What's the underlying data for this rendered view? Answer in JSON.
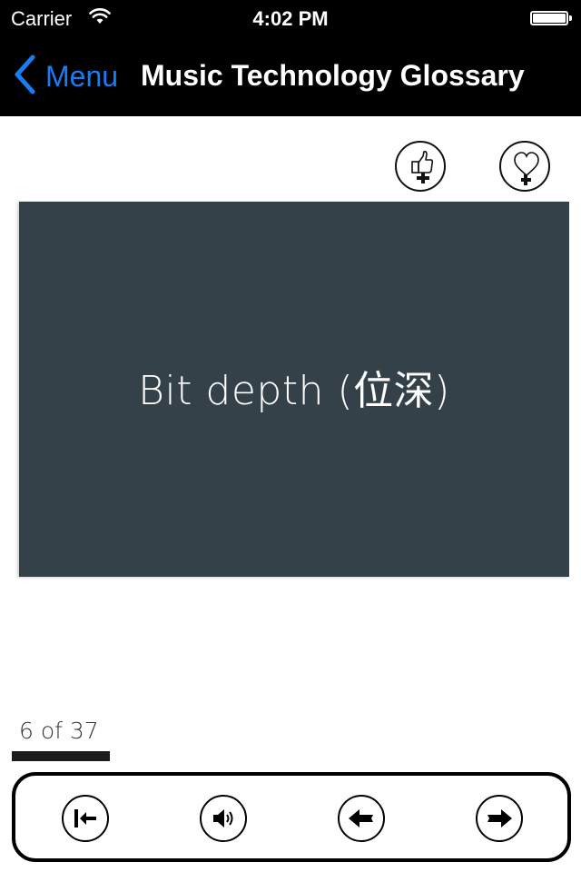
{
  "status_bar": {
    "carrier": "Carrier",
    "time": "4:02 PM",
    "wifi_icon": "wifi-icon",
    "battery_icon": "battery-icon",
    "battery_level_percent": 100
  },
  "nav_bar": {
    "back_label": "Menu",
    "back_icon": "chevron-left-icon",
    "title": "Music Technology Glossary",
    "accent_color": "#1a7cf4"
  },
  "actions": {
    "like_icon": "thumbs-up-plus-icon",
    "favorite_icon": "heart-plus-icon"
  },
  "card": {
    "term": "Bit depth (位深)",
    "background_color": "#344149"
  },
  "pagination": {
    "current": 6,
    "total": 37,
    "label": "6 of 37",
    "progress_fraction": 0.162
  },
  "toolbar": {
    "buttons": [
      {
        "name": "first",
        "icon": "first-card-icon"
      },
      {
        "name": "sound",
        "icon": "speaker-icon"
      },
      {
        "name": "previous",
        "icon": "arrow-left-icon"
      },
      {
        "name": "next",
        "icon": "arrow-right-icon"
      }
    ]
  }
}
